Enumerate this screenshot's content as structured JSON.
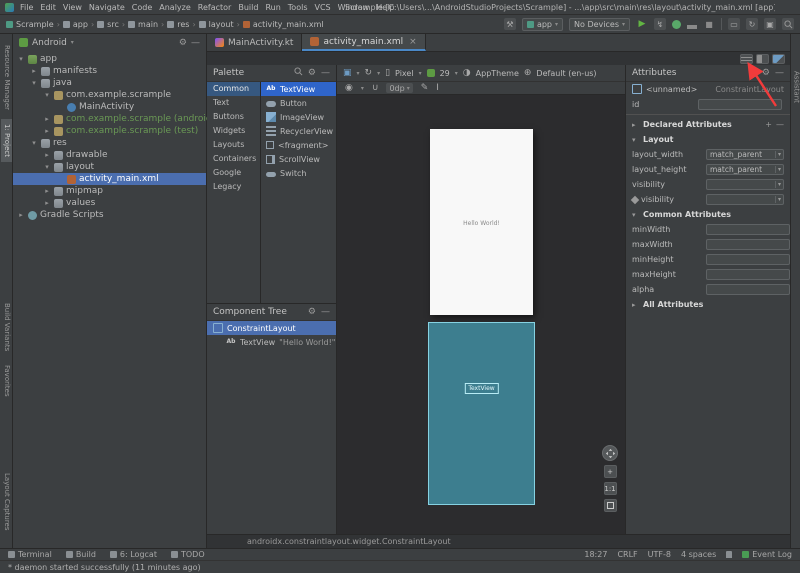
{
  "titlebar": {
    "menus": [
      "File",
      "Edit",
      "View",
      "Navigate",
      "Code",
      "Analyze",
      "Refactor",
      "Build",
      "Run",
      "Tools",
      "VCS",
      "Window",
      "Help"
    ],
    "title": "Scrample [C:\\Users\\...\\AndroidStudioProjects\\Scrample] - ...\\app\\src\\main\\res\\layout\\activity_main.xml [app]"
  },
  "navbar": {
    "crumbs": [
      "Scrample",
      "app",
      "src",
      "main",
      "res",
      "layout",
      "activity_main.xml"
    ],
    "run_config": "app",
    "devices": "No Devices"
  },
  "stripes": {
    "left_top": [
      "Resource Manager",
      "1: Project"
    ],
    "left_mid": [
      "Build Variants",
      "Favorites"
    ],
    "left_bottom": [
      "Layout Captures"
    ],
    "right_top": [
      "Assistant"
    ]
  },
  "project": {
    "view": "Android",
    "tree": [
      {
        "label": "app",
        "depth": 0,
        "arrow": "open",
        "icon": "module"
      },
      {
        "label": "manifests",
        "depth": 1,
        "arrow": "closed",
        "icon": "folder"
      },
      {
        "label": "java",
        "depth": 1,
        "arrow": "open",
        "icon": "folder"
      },
      {
        "label": "com.example.scrample",
        "depth": 2,
        "arrow": "open",
        "icon": "package"
      },
      {
        "label": "MainActivity",
        "depth": 3,
        "arrow": "none",
        "icon": "class"
      },
      {
        "label": "com.example.scrample (androidTest)",
        "depth": 2,
        "arrow": "closed",
        "icon": "package",
        "green": true
      },
      {
        "label": "com.example.scrample (test)",
        "depth": 2,
        "arrow": "closed",
        "icon": "package",
        "green": true
      },
      {
        "label": "res",
        "depth": 1,
        "arrow": "open",
        "icon": "folder"
      },
      {
        "label": "drawable",
        "depth": 2,
        "arrow": "closed",
        "icon": "folder"
      },
      {
        "label": "layout",
        "depth": 2,
        "arrow": "open",
        "icon": "folder"
      },
      {
        "label": "activity_main.xml",
        "depth": 3,
        "arrow": "none",
        "icon": "xml",
        "selected": true
      },
      {
        "label": "mipmap",
        "depth": 2,
        "arrow": "closed",
        "icon": "folder"
      },
      {
        "label": "values",
        "depth": 2,
        "arrow": "closed",
        "icon": "folder"
      },
      {
        "label": "Gradle Scripts",
        "depth": 0,
        "arrow": "closed",
        "icon": "gradle"
      }
    ]
  },
  "tabs": [
    {
      "label": "MainActivity.kt",
      "icon": "kotlin",
      "active": false
    },
    {
      "label": "activity_main.xml",
      "icon": "xml",
      "active": true
    }
  ],
  "palette": {
    "title": "Palette",
    "categories": [
      {
        "label": "Common",
        "selected": true
      },
      {
        "label": "Text"
      },
      {
        "label": "Buttons"
      },
      {
        "label": "Widgets"
      },
      {
        "label": "Layouts"
      },
      {
        "label": "Containers"
      },
      {
        "label": "Google"
      },
      {
        "label": "Legacy"
      }
    ],
    "items": [
      {
        "label": "TextView",
        "icon": "textview",
        "icon_label": "Ab",
        "selected": true
      },
      {
        "label": "Button",
        "icon": "button"
      },
      {
        "label": "ImageView",
        "icon": "imageview"
      },
      {
        "label": "RecyclerView",
        "icon": "recyclerview"
      },
      {
        "label": "<fragment>",
        "icon": "fragment"
      },
      {
        "label": "ScrollView",
        "icon": "scrollview"
      },
      {
        "label": "Switch",
        "icon": "switch"
      }
    ]
  },
  "component_tree": {
    "title": "Component Tree",
    "nodes": [
      {
        "label": "ConstraintLayout",
        "icon": "constraintlayout",
        "depth": 0,
        "selected": true
      },
      {
        "label": "TextView",
        "icon": "textview",
        "icon_label": "Ab",
        "depth": 1,
        "extra": "\"Hello World!\""
      }
    ]
  },
  "design": {
    "device": "Pixel",
    "api": "29",
    "theme": "AppTheme",
    "locale": "Default (en-us)",
    "margin": "0dp",
    "zoom": "1:1",
    "hello": "Hello World!",
    "blueprint_label": "TextView",
    "footer": "androidx.constraintlayout.widget.ConstraintLayout"
  },
  "attributes": {
    "title": "Attributes",
    "component": "<unnamed>",
    "component_type": "ConstraintLayout",
    "id_label": "id",
    "id_value": "",
    "sections": {
      "declared": "Declared Attributes",
      "layout": "Layout",
      "common": "Common Attributes",
      "all": "All Attributes"
    },
    "layout_rows": [
      {
        "label": "layout_width",
        "value": "match_parent"
      },
      {
        "label": "layout_height",
        "value": "match_parent"
      },
      {
        "label": "visibility",
        "value": ""
      },
      {
        "label": "visibility",
        "value": "",
        "tool": true
      }
    ],
    "common_rows": [
      {
        "label": "minWidth",
        "value": ""
      },
      {
        "label": "maxWidth",
        "value": ""
      },
      {
        "label": "minHeight",
        "value": ""
      },
      {
        "label": "maxHeight",
        "value": ""
      },
      {
        "label": "alpha",
        "value": ""
      }
    ]
  },
  "bottom": {
    "tools": [
      "Terminal",
      "Build",
      "6: Logcat",
      "TODO"
    ],
    "widgets": [
      "18:27",
      "CRLF",
      "UTF-8",
      "4 spaces"
    ],
    "event_log": "Event Log",
    "message": "* daemon started successfully (11 minutes ago)"
  },
  "annotation": {
    "arrow_color": "#f23b3b"
  }
}
